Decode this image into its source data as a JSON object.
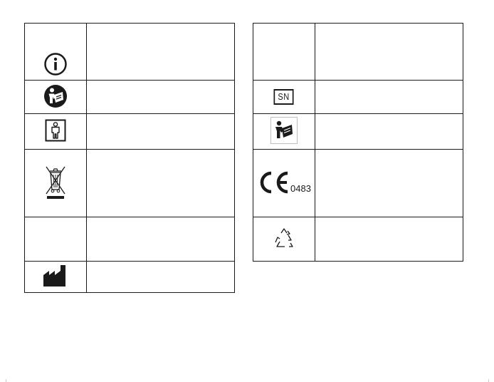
{
  "left_table": {
    "rows": [
      {
        "icon": "info-icon",
        "description": ""
      },
      {
        "icon": "consult-instructions-icon",
        "description": ""
      },
      {
        "icon": "type-bf-applied-part-icon",
        "description": ""
      },
      {
        "icon": "weee-crossed-bin-icon",
        "description": ""
      },
      {
        "icon": "",
        "description": ""
      },
      {
        "icon": "manufacturer-factory-icon",
        "description": ""
      }
    ]
  },
  "right_table": {
    "rows": [
      {
        "icon": "",
        "description": ""
      },
      {
        "icon": "serial-number-icon",
        "label": "SN",
        "description": ""
      },
      {
        "icon": "read-manual-icon",
        "description": ""
      },
      {
        "icon": "ce-mark-icon",
        "notified_body_number": "0483",
        "description": ""
      },
      {
        "icon": "recycle-icon",
        "description": ""
      }
    ]
  },
  "colors": {
    "line": "#1a1a1a",
    "background": "#ffffff"
  }
}
